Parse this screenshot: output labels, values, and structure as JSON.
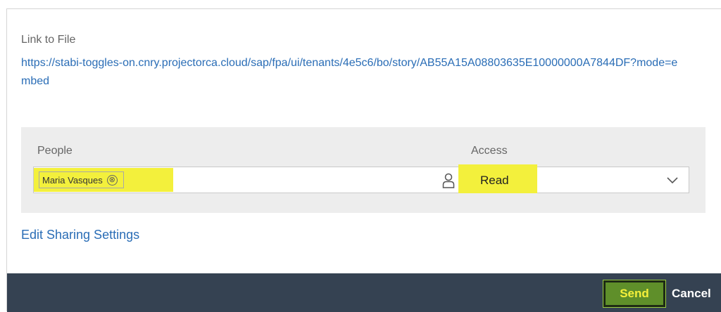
{
  "link": {
    "label": "Link to File",
    "url": "https://stabi-toggles-on.cnry.projectorca.cloud/sap/fpa/ui/tenants/4e5c6/bo/story/AB55A15A08803635E10000000A7844DF?mode=embed"
  },
  "sharing": {
    "people_label": "People",
    "access_label": "Access",
    "people_token": "Maria Vasques",
    "token_remove_glyph": "⊗",
    "access_value": "Read",
    "highlight_color": "#f3f03c",
    "people_icon": "person-icon",
    "access_icon": "chevron-down-icon"
  },
  "edit_sharing_label": "Edit Sharing Settings",
  "footer": {
    "send_label": "Send",
    "cancel_label": "Cancel",
    "background": "#354252"
  }
}
